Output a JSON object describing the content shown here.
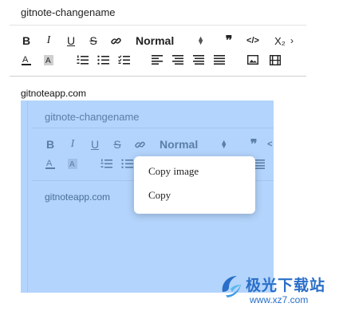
{
  "editor": {
    "title": "gitnote-changename",
    "toolbar_row1": {
      "bold": "B",
      "italic": "I",
      "underline": "U",
      "strike": "S",
      "link_icon": "link-icon",
      "format_value": "Normal",
      "quote": "❞",
      "code": "</>",
      "subscript": "X₂"
    },
    "toolbar_row2": {
      "icons": [
        "font-color-icon",
        "highlight-icon",
        "ordered-list-icon",
        "bullet-list-icon",
        "check-list-icon",
        "align-left-icon",
        "align-center-icon",
        "align-right-icon",
        "justify-icon",
        "image-icon",
        "video-icon"
      ]
    },
    "content_text": "gitnoteapp.com"
  },
  "pasted_image": {
    "title": "gitnote-changename",
    "format_value": "Normal",
    "content_text": "gitnoteapp.com",
    "highlight_color": "#b3d4fc"
  },
  "context_menu": {
    "items": [
      {
        "label": "Copy image"
      },
      {
        "label": "Copy"
      }
    ]
  },
  "watermark": {
    "logo_icon": "jiguang-logo-icon",
    "site_name": "极光下载站",
    "url": "www.xz7.com",
    "color": "#2a6fc9"
  }
}
